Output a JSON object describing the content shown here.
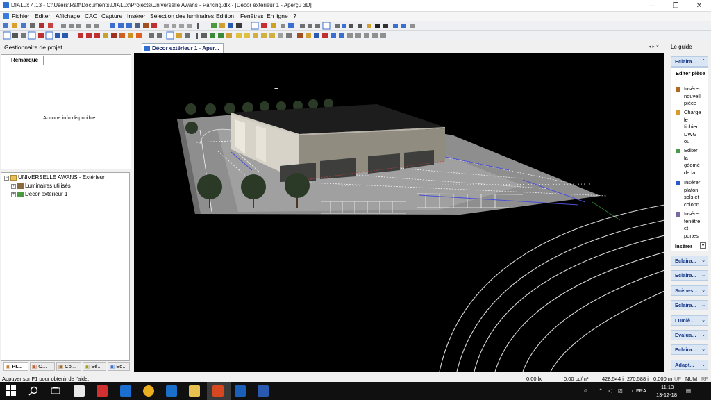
{
  "window": {
    "title": "DIALux 4.13 - C:\\Users\\Raff\\Documents\\DIALux\\Projects\\Universelle Awans - Parking.dlx - [Décor extérieur 1 - Aperçu 3D]",
    "minimize": "—",
    "maximize": "❐",
    "close": "✕"
  },
  "menu": [
    "Fichier",
    "Editer",
    "Affichage",
    "CAO",
    "Capture",
    "Insérer",
    "Sélection des luminaires",
    "Edition",
    "Fenêtres",
    "En ligne",
    "?"
  ],
  "left_panel": {
    "title": "Gestionnaire de projet",
    "remark_tab": "Remarque",
    "remark_text": "Aucune info disponible",
    "tree": {
      "root": "UNIVERSELLE AWANS - Extérieur",
      "children": [
        "Luminaires utilisés",
        "Décor extérieur 1"
      ]
    },
    "bottom_tabs": [
      "Pr...",
      "O...",
      "Co...",
      "Sé...",
      "Ed..."
    ]
  },
  "document": {
    "tab": "Décor extérieur 1 - Aper...",
    "nav": "◂ ▸ ×"
  },
  "guide": {
    "title": "Le guide",
    "open_section": {
      "label": "Eclaira...",
      "heading": "Editer pièce",
      "items": [
        {
          "lines": [
            "Insérer",
            "nouvell",
            "pièce"
          ],
          "color": "#b06a20"
        },
        {
          "lines": [
            "Charge",
            "le",
            "fichier",
            "DWG",
            "ou"
          ],
          "color": "#d89a28"
        },
        {
          "lines": [
            "Editer",
            "la",
            "géomé",
            "de la"
          ],
          "color": "#4a9a4a"
        },
        {
          "lines": [
            "Insérer",
            "plafon",
            "sols et",
            "colonn"
          ],
          "color": "#2a5ad0"
        },
        {
          "lines": [
            "Insérer",
            "fenêtre",
            "et",
            "portes"
          ],
          "color": "#7a6aa0"
        }
      ],
      "footer": "Insérer"
    },
    "sections": [
      "Eclaira...",
      "Eclaira...",
      "Scènes...",
      "Eclaira...",
      "Lumiè...",
      "Evalua...",
      "Eclaira...",
      "Adapt..."
    ]
  },
  "status": {
    "help": "Appuyer sur F1 pour obtenir de l'aide.",
    "lux": "0.00 lx",
    "lum": "0.00 cd/m²",
    "coord1": "428.544 i",
    "coord2": "270.588 i",
    "coord3": "0.000 m",
    "uf": "UF",
    "num": "NUM",
    "rf": "RF"
  },
  "taskbar": {
    "time": "11:13",
    "date": "13-12-18",
    "lang": "FRA"
  }
}
